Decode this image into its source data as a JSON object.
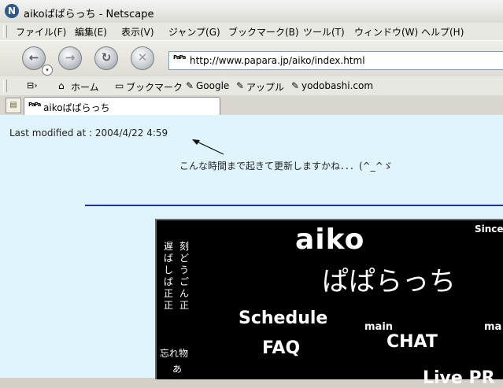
{
  "window": {
    "title": "aikoぱぱらっち - Netscape",
    "app_icon": "N"
  },
  "menu": [
    "ファイル(F)",
    "編集(E)",
    "表示(V)",
    "ジャンプ(G)",
    "ブックマーク(B)",
    "ツール(T)",
    "ウィンドウ(W)",
    "ヘルプ(H)"
  ],
  "nav": {
    "url": "http://www.papara.jp/aiko/index.html",
    "site_icon": "PaPa",
    "back_glyph": "←",
    "forward_glyph": "→",
    "reload_glyph": "↻",
    "stop_glyph": "✕",
    "dropdown_glyph": "▾"
  },
  "personal_toolbar": {
    "home": "ホーム",
    "bookmarks": "ブックマーク",
    "links": [
      "Google",
      "アップル",
      "yodobashi.com"
    ]
  },
  "tabs": [
    {
      "label": "aikoぱぱらっち",
      "icon": "PaPa"
    }
  ],
  "content": {
    "last_modified": "Last modified at : 2004/4/22 4:59",
    "comment": "こんな時間まで起きて更新しますかね．．．(^_^ゞ",
    "banner": {
      "title1": "aiko",
      "title2": "ぱぱらっち",
      "since": "Since",
      "schedule": "Schedule",
      "faq": "FAQ",
      "main1": "main",
      "chat": "CHAT",
      "main2": "ma",
      "live": "Live PR",
      "left_col1": [
        "遅",
        "ば",
        "し",
        "ば",
        "正",
        "正"
      ],
      "left_col2": [
        "刻",
        "ど",
        "う",
        "ご",
        "ん",
        "正"
      ],
      "left_col3": [
        "",
        "",
        "",
        "",
        "",
        ""
      ],
      "forgot": "忘れ物",
      "forgot2": "あ"
    }
  }
}
